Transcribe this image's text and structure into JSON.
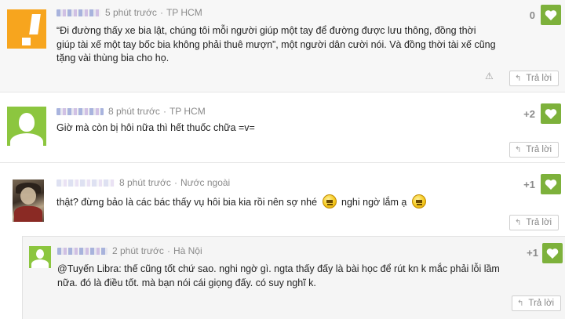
{
  "comments": [
    {
      "time": "5 phút trước",
      "location": "TP HCM",
      "text": "“Đi đường thấy xe bia lật, chúng tôi mỗi người giúp một tay để đường được lưu thông, đồng thời giúp tài xế một tay bốc bia không phải thuê mượn”, một người dân cười nói. Và đồng thời tài xế cũng tặng vài thùng bia cho họ.",
      "score": "0",
      "reply_label": "Trả lời",
      "report_icon": "warning-icon"
    },
    {
      "time": "8 phút trước",
      "location": "TP HCM",
      "text": "Giờ mà còn bị hôi nữa thì hết thuốc chữa =v=",
      "score": "+2",
      "reply_label": "Trả lời"
    },
    {
      "time": "8 phút trước",
      "location": "Nước ngoài",
      "text_a": "thật? đừng bảo là các bác thấy vụ hôi bia kia rồi nên sợ nhé",
      "text_b": "nghi ngờ lắm ạ",
      "score": "+1",
      "reply_label": "Trả lời"
    },
    {
      "time": "2 phút trước",
      "location": "Hà Nội",
      "text": "@Tuyến Libra: thế cũng tốt chứ sao. nghi ngờ gì. ngta thấy đấy là bài học để rút kn k mắc phải lỗi lầm nữa. đó là điều tốt. mà bạn nói cái giọng đấy. có suy nghĩ k.",
      "score": "+1",
      "reply_label": "Trả lời"
    }
  ],
  "meta_separator": "·",
  "colors": {
    "like_green": "#7db13b",
    "avatar_orange": "#f7a51e",
    "avatar_green": "#8cc63f"
  }
}
